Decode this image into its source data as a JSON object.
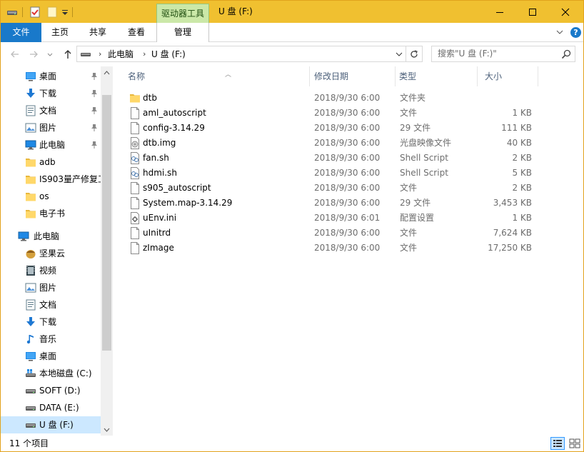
{
  "titlebar": {
    "context_tab": "驱动器工具",
    "title": "U 盘 (F:)"
  },
  "ribbon": {
    "tabs": [
      "文件",
      "主页",
      "共享",
      "查看",
      "管理"
    ]
  },
  "address": {
    "segments": [
      "此电脑",
      "U 盘 (F:)"
    ],
    "search_placeholder": "搜索\"U 盘 (F:)\""
  },
  "nav": {
    "items": [
      {
        "label": "桌面",
        "icon": "desktop-icon",
        "indent": 0,
        "pinned": true
      },
      {
        "label": "下载",
        "icon": "download-icon",
        "indent": 0,
        "pinned": true
      },
      {
        "label": "文档",
        "icon": "documents-icon",
        "indent": 0,
        "pinned": true
      },
      {
        "label": "图片",
        "icon": "pictures-icon",
        "indent": 0,
        "pinned": true
      },
      {
        "label": "此电脑",
        "icon": "computer-icon",
        "indent": 0,
        "pinned": true
      },
      {
        "label": "adb",
        "icon": "folder-icon",
        "indent": 0,
        "pinned": false
      },
      {
        "label": "IS903量产修复工",
        "icon": "folder-icon",
        "indent": 0,
        "pinned": false
      },
      {
        "label": "os",
        "icon": "folder-icon",
        "indent": 0,
        "pinned": false
      },
      {
        "label": "电子书",
        "icon": "folder-icon",
        "indent": 0,
        "pinned": false
      },
      {
        "label": "此电脑",
        "icon": "computer-icon",
        "indent": -1,
        "pinned": false
      },
      {
        "label": "坚果云",
        "icon": "nutstore-icon",
        "indent": 0,
        "pinned": false
      },
      {
        "label": "视频",
        "icon": "videos-icon",
        "indent": 0,
        "pinned": false
      },
      {
        "label": "图片",
        "icon": "pictures-icon",
        "indent": 0,
        "pinned": false
      },
      {
        "label": "文档",
        "icon": "documents-icon",
        "indent": 0,
        "pinned": false
      },
      {
        "label": "下载",
        "icon": "download-icon",
        "indent": 0,
        "pinned": false
      },
      {
        "label": "音乐",
        "icon": "music-icon",
        "indent": 0,
        "pinned": false
      },
      {
        "label": "桌面",
        "icon": "desktop-icon",
        "indent": 0,
        "pinned": false
      },
      {
        "label": "本地磁盘 (C:)",
        "icon": "system-drive-icon",
        "indent": 0,
        "pinned": false
      },
      {
        "label": "SOFT (D:)",
        "icon": "drive-icon",
        "indent": 0,
        "pinned": false
      },
      {
        "label": "DATA (E:)",
        "icon": "drive-icon",
        "indent": 0,
        "pinned": false
      },
      {
        "label": "U 盘 (F:)",
        "icon": "usb-drive-icon",
        "indent": 0,
        "pinned": false,
        "selected": true
      }
    ]
  },
  "columns": {
    "name": "名称",
    "date": "修改日期",
    "type": "类型",
    "size": "大小"
  },
  "files": [
    {
      "name": "dtb",
      "date": "2018/9/30 6:00",
      "type": "文件夹",
      "size": "",
      "icon": "folder-icon"
    },
    {
      "name": "aml_autoscript",
      "date": "2018/9/30 6:00",
      "type": "文件",
      "size": "1 KB",
      "icon": "file-icon"
    },
    {
      "name": "config-3.14.29",
      "date": "2018/9/30 6:00",
      "type": "29 文件",
      "size": "111 KB",
      "icon": "file-icon"
    },
    {
      "name": "dtb.img",
      "date": "2018/9/30 6:00",
      "type": "光盘映像文件",
      "size": "40 KB",
      "icon": "disc-image-icon"
    },
    {
      "name": "fan.sh",
      "date": "2018/9/30 6:00",
      "type": "Shell Script",
      "size": "2 KB",
      "icon": "script-icon"
    },
    {
      "name": "hdmi.sh",
      "date": "2018/9/30 6:00",
      "type": "Shell Script",
      "size": "5 KB",
      "icon": "script-icon"
    },
    {
      "name": "s905_autoscript",
      "date": "2018/9/30 6:00",
      "type": "文件",
      "size": "2 KB",
      "icon": "file-icon"
    },
    {
      "name": "System.map-3.14.29",
      "date": "2018/9/30 6:00",
      "type": "29 文件",
      "size": "3,453 KB",
      "icon": "file-icon"
    },
    {
      "name": "uEnv.ini",
      "date": "2018/9/30 6:01",
      "type": "配置设置",
      "size": "1 KB",
      "icon": "settings-file-icon"
    },
    {
      "name": "uInitrd",
      "date": "2018/9/30 6:00",
      "type": "文件",
      "size": "7,624 KB",
      "icon": "file-icon"
    },
    {
      "name": "zImage",
      "date": "2018/9/30 6:00",
      "type": "文件",
      "size": "17,250 KB",
      "icon": "file-icon"
    }
  ],
  "status": {
    "count": "11 个项目"
  },
  "colors": {
    "title_bar": "#f0c030",
    "file_tab": "#1979ca",
    "context_tab": "#cbe8a8",
    "selection": "#cce8ff"
  }
}
